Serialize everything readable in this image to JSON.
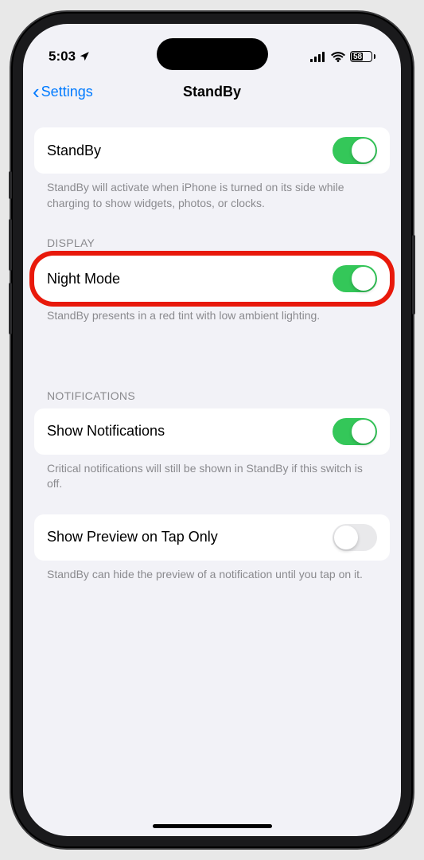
{
  "status": {
    "time": "5:03",
    "battery": "58"
  },
  "nav": {
    "back": "Settings",
    "title": "StandBy"
  },
  "sections": {
    "standby": {
      "label": "StandBy",
      "footer": "StandBy will activate when iPhone is turned on its side while charging to show widgets, photos, or clocks."
    },
    "display": {
      "header": "DISPLAY",
      "nightmode_label": "Night Mode",
      "footer": "StandBy presents in a red tint with low ambient lighting."
    },
    "notifications": {
      "header": "NOTIFICATIONS",
      "show_label": "Show Notifications",
      "show_footer": "Critical notifications will still be shown in StandBy if this switch is off.",
      "preview_label": "Show Preview on Tap Only",
      "preview_footer": "StandBy can hide the preview of a notification until you tap on it."
    }
  }
}
